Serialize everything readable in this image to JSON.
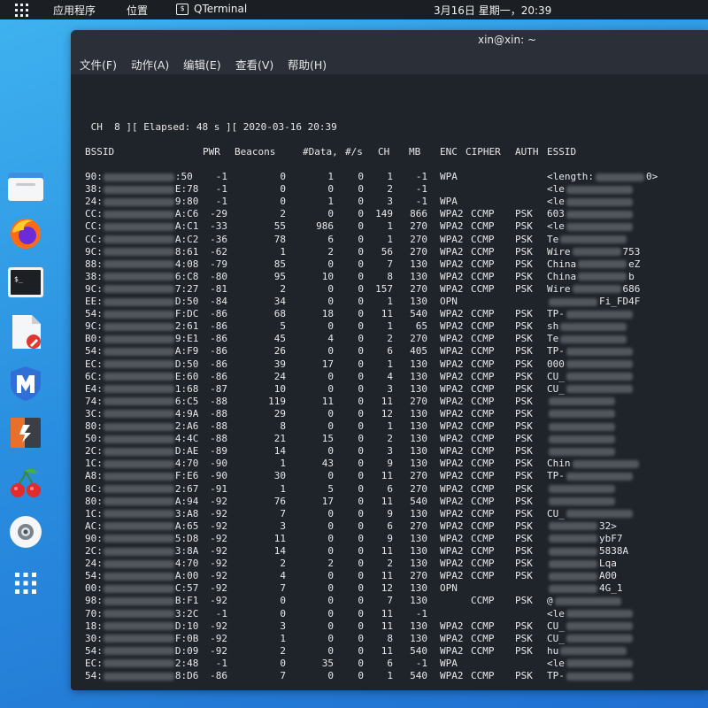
{
  "topbar": {
    "applications": "应用程序",
    "places": "位置",
    "active_app": "QTerminal",
    "clock": "3月16日 星期一，20:39"
  },
  "dock": [
    {
      "name": "files-icon"
    },
    {
      "name": "firefox-icon"
    },
    {
      "name": "terminal-icon"
    },
    {
      "name": "text-editor-icon"
    },
    {
      "name": "metasploit-icon"
    },
    {
      "name": "burpsuite-icon"
    },
    {
      "name": "cherrytree-icon"
    },
    {
      "name": "disc-icon"
    },
    {
      "name": "show-apps-icon"
    }
  ],
  "window": {
    "title": "xin@xin: ~",
    "menu": [
      "文件(F)",
      "动作(A)",
      "编辑(E)",
      "查看(V)",
      "帮助(H)"
    ]
  },
  "status_line": " CH  8 ][ Elapsed: 48 s ][ 2020-03-16 20:39",
  "headers": {
    "bssid": "BSSID",
    "pwr": "PWR",
    "beacons": "Beacons",
    "data": "#Data,",
    "per_s": "#/s",
    "ch": "CH",
    "mb": "MB",
    "enc": "ENC",
    "cipher": "CIPHER",
    "auth": "AUTH",
    "essid": "ESSID"
  },
  "rows": [
    {
      "bp": "90:",
      "bs": ":50",
      "pwr": "-1",
      "beacons": "0",
      "data": "1",
      "per_s": "0",
      "ch": "1",
      "mb": "-1",
      "enc": "WPA",
      "cipher": "",
      "auth": "",
      "ep": "<length:",
      "es": "0>"
    },
    {
      "bp": "38:",
      "bs": "E:78",
      "pwr": "-1",
      "beacons": "0",
      "data": "0",
      "per_s": "0",
      "ch": "2",
      "mb": "-1",
      "enc": "",
      "cipher": "",
      "auth": "",
      "ep": "<le",
      "es": ""
    },
    {
      "bp": "24:",
      "bs": "9:80",
      "pwr": "-1",
      "beacons": "0",
      "data": "1",
      "per_s": "0",
      "ch": "3",
      "mb": "-1",
      "enc": "WPA",
      "cipher": "",
      "auth": "",
      "ep": "<le",
      "es": ""
    },
    {
      "bp": "CC:",
      "bs": "A:C6",
      "pwr": "-29",
      "beacons": "2",
      "data": "0",
      "per_s": "0",
      "ch": "149",
      "mb": "866",
      "enc": "WPA2",
      "cipher": "CCMP",
      "auth": "PSK",
      "ep": "603",
      "es": ""
    },
    {
      "bp": "CC:",
      "bs": "A:C1",
      "pwr": "-33",
      "beacons": "55",
      "data": "986",
      "per_s": "0",
      "ch": "1",
      "mb": "270",
      "enc": "WPA2",
      "cipher": "CCMP",
      "auth": "PSK",
      "ep": "<le",
      "es": ""
    },
    {
      "bp": "CC:",
      "bs": "A:C2",
      "pwr": "-36",
      "beacons": "78",
      "data": "6",
      "per_s": "0",
      "ch": "1",
      "mb": "270",
      "enc": "WPA2",
      "cipher": "CCMP",
      "auth": "PSK",
      "ep": "Te",
      "es": ""
    },
    {
      "bp": "9C:",
      "bs": "8:61",
      "pwr": "-62",
      "beacons": "1",
      "data": "2",
      "per_s": "0",
      "ch": "56",
      "mb": "270",
      "enc": "WPA2",
      "cipher": "CCMP",
      "auth": "PSK",
      "ep": "Wire",
      "es": "753"
    },
    {
      "bp": "88:",
      "bs": "4:08",
      "pwr": "-79",
      "beacons": "85",
      "data": "0",
      "per_s": "0",
      "ch": "7",
      "mb": "130",
      "enc": "WPA2",
      "cipher": "CCMP",
      "auth": "PSK",
      "ep": "China",
      "es": "eZ"
    },
    {
      "bp": "38:",
      "bs": "6:C8",
      "pwr": "-80",
      "beacons": "95",
      "data": "10",
      "per_s": "0",
      "ch": "8",
      "mb": "130",
      "enc": "WPA2",
      "cipher": "CCMP",
      "auth": "PSK",
      "ep": "China",
      "es": "b"
    },
    {
      "bp": "9C:",
      "bs": "7:27",
      "pwr": "-81",
      "beacons": "2",
      "data": "0",
      "per_s": "0",
      "ch": "157",
      "mb": "270",
      "enc": "WPA2",
      "cipher": "CCMP",
      "auth": "PSK",
      "ep": "Wire",
      "es": "686"
    },
    {
      "bp": "EE:",
      "bs": "D:50",
      "pwr": "-84",
      "beacons": "34",
      "data": "0",
      "per_s": "0",
      "ch": "1",
      "mb": "130",
      "enc": "OPN",
      "cipher": "",
      "auth": "",
      "ep": "",
      "es": "Fi_FD4F"
    },
    {
      "bp": "54:",
      "bs": "F:DC",
      "pwr": "-86",
      "beacons": "68",
      "data": "18",
      "per_s": "0",
      "ch": "11",
      "mb": "540",
      "enc": "WPA2",
      "cipher": "CCMP",
      "auth": "PSK",
      "ep": "TP-",
      "es": ""
    },
    {
      "bp": "9C:",
      "bs": "2:61",
      "pwr": "-86",
      "beacons": "5",
      "data": "0",
      "per_s": "0",
      "ch": "1",
      "mb": "65",
      "enc": "WPA2",
      "cipher": "CCMP",
      "auth": "PSK",
      "ep": "sh",
      "es": ""
    },
    {
      "bp": "B0:",
      "bs": "9:E1",
      "pwr": "-86",
      "beacons": "45",
      "data": "4",
      "per_s": "0",
      "ch": "2",
      "mb": "270",
      "enc": "WPA2",
      "cipher": "CCMP",
      "auth": "PSK",
      "ep": "Te",
      "es": ""
    },
    {
      "bp": "54:",
      "bs": "A:F9",
      "pwr": "-86",
      "beacons": "26",
      "data": "0",
      "per_s": "0",
      "ch": "6",
      "mb": "405",
      "enc": "WPA2",
      "cipher": "CCMP",
      "auth": "PSK",
      "ep": "TP-",
      "es": ""
    },
    {
      "bp": "EC:",
      "bs": "D:50",
      "pwr": "-86",
      "beacons": "39",
      "data": "17",
      "per_s": "0",
      "ch": "1",
      "mb": "130",
      "enc": "WPA2",
      "cipher": "CCMP",
      "auth": "PSK",
      "ep": "000",
      "es": ""
    },
    {
      "bp": "6C:",
      "bs": "E:60",
      "pwr": "-86",
      "beacons": "24",
      "data": "0",
      "per_s": "0",
      "ch": "4",
      "mb": "130",
      "enc": "WPA2",
      "cipher": "CCMP",
      "auth": "PSK",
      "ep": "CU_",
      "es": ""
    },
    {
      "bp": "E4:",
      "bs": "1:68",
      "pwr": "-87",
      "beacons": "10",
      "data": "0",
      "per_s": "0",
      "ch": "3",
      "mb": "130",
      "enc": "WPA2",
      "cipher": "CCMP",
      "auth": "PSK",
      "ep": "CU_",
      "es": ""
    },
    {
      "bp": "74:",
      "bs": "6:C5",
      "pwr": "-88",
      "beacons": "119",
      "data": "11",
      "per_s": "0",
      "ch": "11",
      "mb": "270",
      "enc": "WPA2",
      "cipher": "CCMP",
      "auth": "PSK",
      "ep": "",
      "es": ""
    },
    {
      "bp": "3C:",
      "bs": "4:9A",
      "pwr": "-88",
      "beacons": "29",
      "data": "0",
      "per_s": "0",
      "ch": "12",
      "mb": "130",
      "enc": "WPA2",
      "cipher": "CCMP",
      "auth": "PSK",
      "ep": "",
      "es": ""
    },
    {
      "bp": "80:",
      "bs": "2:A6",
      "pwr": "-88",
      "beacons": "8",
      "data": "0",
      "per_s": "0",
      "ch": "1",
      "mb": "130",
      "enc": "WPA2",
      "cipher": "CCMP",
      "auth": "PSK",
      "ep": "",
      "es": ""
    },
    {
      "bp": "50:",
      "bs": "4:4C",
      "pwr": "-88",
      "beacons": "21",
      "data": "15",
      "per_s": "0",
      "ch": "2",
      "mb": "130",
      "enc": "WPA2",
      "cipher": "CCMP",
      "auth": "PSK",
      "ep": "",
      "es": ""
    },
    {
      "bp": "2C:",
      "bs": "D:AE",
      "pwr": "-89",
      "beacons": "14",
      "data": "0",
      "per_s": "0",
      "ch": "3",
      "mb": "130",
      "enc": "WPA2",
      "cipher": "CCMP",
      "auth": "PSK",
      "ep": "",
      "es": ""
    },
    {
      "bp": "1C:",
      "bs": "4:70",
      "pwr": "-90",
      "beacons": "1",
      "data": "43",
      "per_s": "0",
      "ch": "9",
      "mb": "130",
      "enc": "WPA2",
      "cipher": "CCMP",
      "auth": "PSK",
      "ep": "Chin",
      "es": ""
    },
    {
      "bp": "A8:",
      "bs": "F:E6",
      "pwr": "-90",
      "beacons": "30",
      "data": "0",
      "per_s": "0",
      "ch": "11",
      "mb": "270",
      "enc": "WPA2",
      "cipher": "CCMP",
      "auth": "PSK",
      "ep": "TP-",
      "es": ""
    },
    {
      "bp": "8C:",
      "bs": "2:67",
      "pwr": "-91",
      "beacons": "1",
      "data": "5",
      "per_s": "0",
      "ch": "6",
      "mb": "270",
      "enc": "WPA2",
      "cipher": "CCMP",
      "auth": "PSK",
      "ep": "",
      "es": ""
    },
    {
      "bp": "80:",
      "bs": "A:94",
      "pwr": "-92",
      "beacons": "76",
      "data": "17",
      "per_s": "0",
      "ch": "11",
      "mb": "540",
      "enc": "WPA2",
      "cipher": "CCMP",
      "auth": "PSK",
      "ep": "",
      "es": ""
    },
    {
      "bp": "1C:",
      "bs": "3:A8",
      "pwr": "-92",
      "beacons": "7",
      "data": "0",
      "per_s": "0",
      "ch": "9",
      "mb": "130",
      "enc": "WPA2",
      "cipher": "CCMP",
      "auth": "PSK",
      "ep": "CU_",
      "es": ""
    },
    {
      "bp": "AC:",
      "bs": "A:65",
      "pwr": "-92",
      "beacons": "3",
      "data": "0",
      "per_s": "0",
      "ch": "6",
      "mb": "270",
      "enc": "WPA2",
      "cipher": "CCMP",
      "auth": "PSK",
      "ep": "",
      "es": "32>"
    },
    {
      "bp": "90:",
      "bs": "5:D8",
      "pwr": "-92",
      "beacons": "11",
      "data": "0",
      "per_s": "0",
      "ch": "9",
      "mb": "130",
      "enc": "WPA2",
      "cipher": "CCMP",
      "auth": "PSK",
      "ep": "",
      "es": "ybF7"
    },
    {
      "bp": "2C:",
      "bs": "3:8A",
      "pwr": "-92",
      "beacons": "14",
      "data": "0",
      "per_s": "0",
      "ch": "11",
      "mb": "130",
      "enc": "WPA2",
      "cipher": "CCMP",
      "auth": "PSK",
      "ep": "",
      "es": "5838A"
    },
    {
      "bp": "24:",
      "bs": "4:70",
      "pwr": "-92",
      "beacons": "2",
      "data": "2",
      "per_s": "0",
      "ch": "2",
      "mb": "130",
      "enc": "WPA2",
      "cipher": "CCMP",
      "auth": "PSK",
      "ep": "",
      "es": "Lqa"
    },
    {
      "bp": "54:",
      "bs": "A:00",
      "pwr": "-92",
      "beacons": "4",
      "data": "0",
      "per_s": "0",
      "ch": "11",
      "mb": "270",
      "enc": "WPA2",
      "cipher": "CCMP",
      "auth": "PSK",
      "ep": "",
      "es": "A00"
    },
    {
      "bp": "00:",
      "bs": "C:57",
      "pwr": "-92",
      "beacons": "7",
      "data": "0",
      "per_s": "0",
      "ch": "12",
      "mb": "130",
      "enc": "OPN",
      "cipher": "",
      "auth": "",
      "ep": "",
      "es": "4G_1"
    },
    {
      "bp": "98:",
      "bs": "B:F1",
      "pwr": "-92",
      "beacons": "0",
      "data": "0",
      "per_s": "0",
      "ch": "7",
      "mb": "130",
      "enc": "",
      "cipher": "CCMP",
      "auth": "PSK",
      "ep": "@",
      "es": ""
    },
    {
      "bp": "70:",
      "bs": "3:2C",
      "pwr": "-1",
      "beacons": "0",
      "data": "0",
      "per_s": "0",
      "ch": "11",
      "mb": "-1",
      "enc": "",
      "cipher": "",
      "auth": "",
      "ep": "<le",
      "es": ""
    },
    {
      "bp": "18:",
      "bs": "D:10",
      "pwr": "-92",
      "beacons": "3",
      "data": "0",
      "per_s": "0",
      "ch": "11",
      "mb": "130",
      "enc": "WPA2",
      "cipher": "CCMP",
      "auth": "PSK",
      "ep": "CU_",
      "es": ""
    },
    {
      "bp": "30:",
      "bs": "F:0B",
      "pwr": "-92",
      "beacons": "1",
      "data": "0",
      "per_s": "0",
      "ch": "8",
      "mb": "130",
      "enc": "WPA2",
      "cipher": "CCMP",
      "auth": "PSK",
      "ep": "CU_",
      "es": ""
    },
    {
      "bp": "54:",
      "bs": "D:09",
      "pwr": "-92",
      "beacons": "2",
      "data": "0",
      "per_s": "0",
      "ch": "11",
      "mb": "540",
      "enc": "WPA2",
      "cipher": "CCMP",
      "auth": "PSK",
      "ep": "hu",
      "es": ""
    },
    {
      "bp": "EC:",
      "bs": "2:48",
      "pwr": "-1",
      "beacons": "0",
      "data": "35",
      "per_s": "0",
      "ch": "6",
      "mb": "-1",
      "enc": "WPA",
      "cipher": "",
      "auth": "",
      "ep": "<le",
      "es": ""
    },
    {
      "bp": "54:",
      "bs": "8:D6",
      "pwr": "-86",
      "beacons": "7",
      "data": "0",
      "per_s": "0",
      "ch": "1",
      "mb": "540",
      "enc": "WPA2",
      "cipher": "CCMP",
      "auth": "PSK",
      "ep": "TP-",
      "es": ""
    }
  ]
}
